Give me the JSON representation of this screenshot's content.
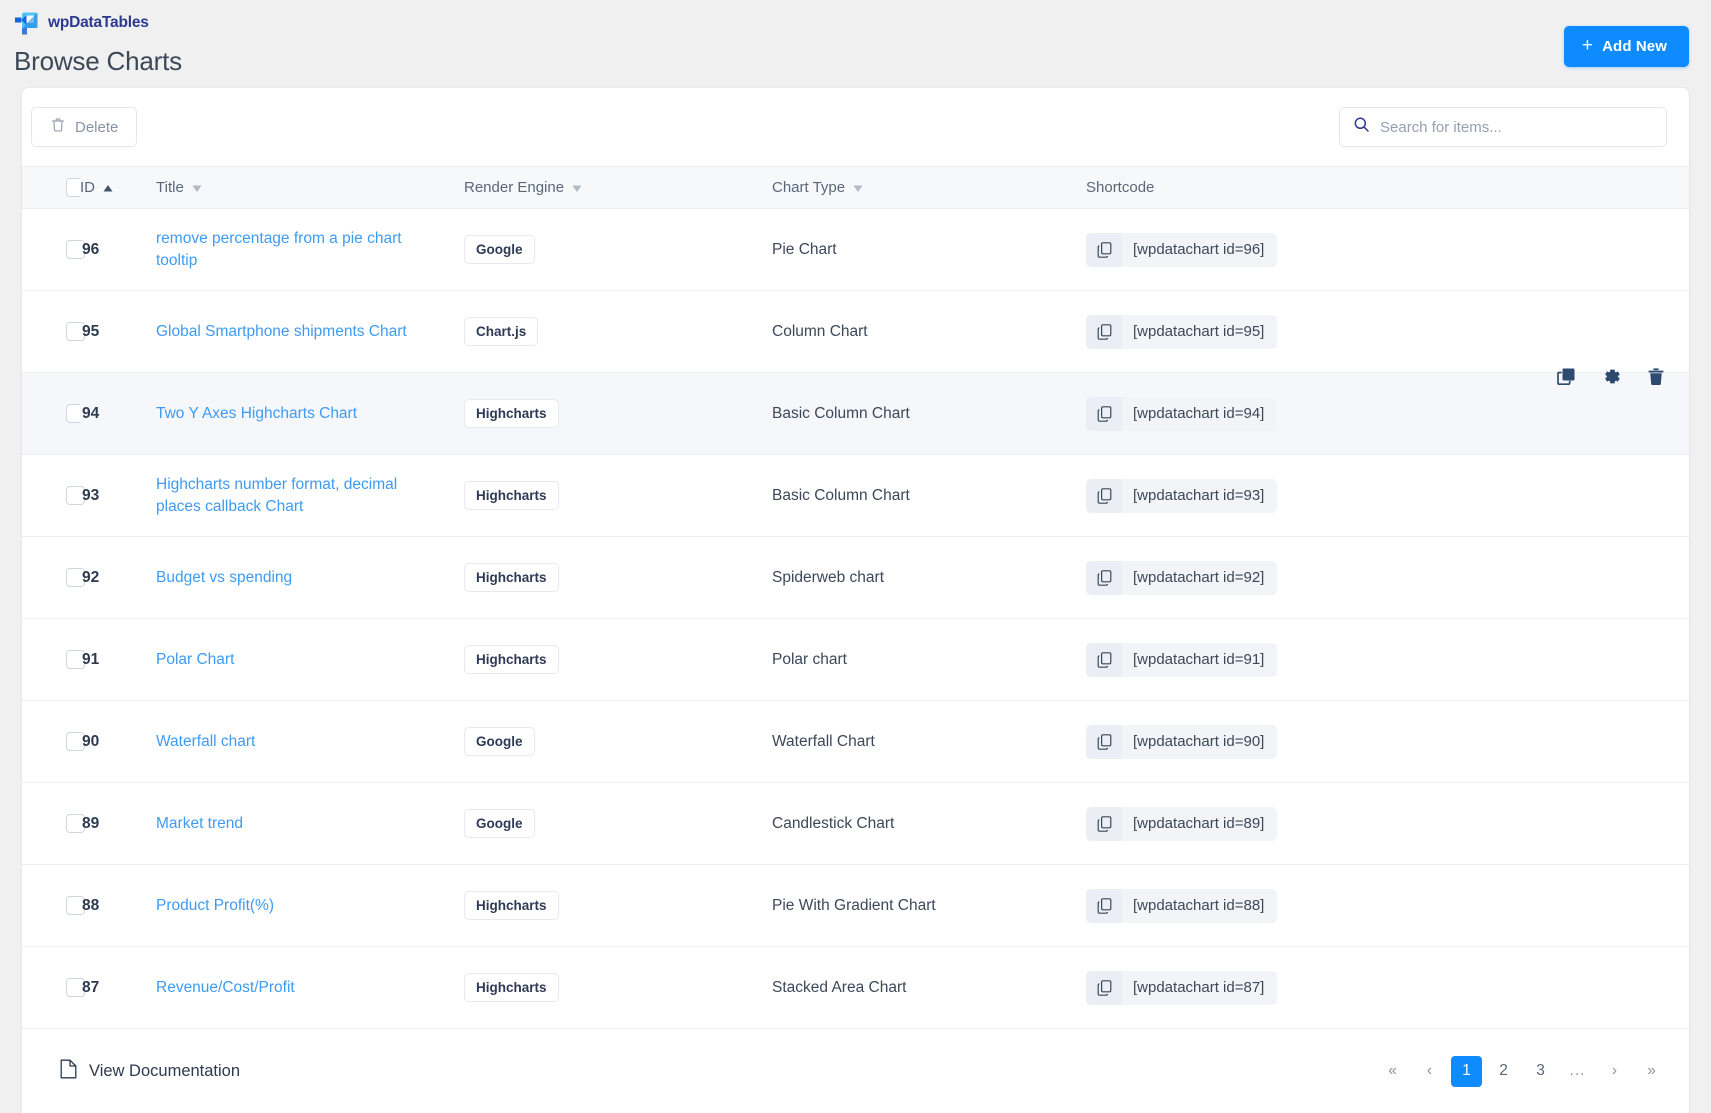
{
  "app": {
    "brand_name": "wpDataTables",
    "page_title": "Browse Charts",
    "add_new_label": "Add New",
    "add_new_plus": "+",
    "accent_color": "#0d8bff",
    "link_color": "#3e9bf4"
  },
  "toolbar": {
    "delete_label": "Delete",
    "search_placeholder": "Search for items...",
    "search_value": ""
  },
  "table": {
    "columns": [
      {
        "key": "check",
        "label": "",
        "sort": "none"
      },
      {
        "key": "id",
        "label": "ID",
        "sort": "asc"
      },
      {
        "key": "title",
        "label": "Title",
        "sort": "desc"
      },
      {
        "key": "engine",
        "label": "Render Engine",
        "sort": "desc"
      },
      {
        "key": "charttype",
        "label": "Chart Type",
        "sort": "desc"
      },
      {
        "key": "shortcode",
        "label": "Shortcode",
        "sort": "none"
      }
    ],
    "rows": [
      {
        "id": "96",
        "title": "remove percentage from a pie chart tooltip",
        "engine": "Google",
        "type": "Pie Chart",
        "shortcode": "[wpdatachart id=96]",
        "hovered": false
      },
      {
        "id": "95",
        "title": "Global Smartphone shipments Chart",
        "engine": "Chart.js",
        "type": "Column Chart",
        "shortcode": "[wpdatachart id=95]",
        "hovered": false
      },
      {
        "id": "94",
        "title": "Two Y Axes Highcharts Chart",
        "engine": "Highcharts",
        "type": "Basic Column Chart",
        "shortcode": "[wpdatachart id=94]",
        "hovered": true
      },
      {
        "id": "93",
        "title": "Highcharts number format, decimal places callback Chart",
        "engine": "Highcharts",
        "type": "Basic Column Chart",
        "shortcode": "[wpdatachart id=93]",
        "hovered": false
      },
      {
        "id": "92",
        "title": "Budget vs spending",
        "engine": "Highcharts",
        "type": "Spiderweb chart",
        "shortcode": "[wpdatachart id=92]",
        "hovered": false
      },
      {
        "id": "91",
        "title": "Polar Chart",
        "engine": "Highcharts",
        "type": "Polar chart",
        "shortcode": "[wpdatachart id=91]",
        "hovered": false
      },
      {
        "id": "90",
        "title": "Waterfall chart",
        "engine": "Google",
        "type": "Waterfall Chart",
        "shortcode": "[wpdatachart id=90]",
        "hovered": false
      },
      {
        "id": "89",
        "title": "Market trend",
        "engine": "Google",
        "type": "Candlestick Chart",
        "shortcode": "[wpdatachart id=89]",
        "hovered": false
      },
      {
        "id": "88",
        "title": "Product Profit(%)",
        "engine": "Highcharts",
        "type": "Pie With Gradient Chart",
        "shortcode": "[wpdatachart id=88]",
        "hovered": false
      },
      {
        "id": "87",
        "title": "Revenue/Cost/Profit",
        "engine": "Highcharts",
        "type": "Stacked Area Chart",
        "shortcode": "[wpdatachart id=87]",
        "hovered": false
      }
    ],
    "row_actions": [
      "duplicate-icon",
      "gear-icon",
      "trash-icon"
    ]
  },
  "footer": {
    "doc_label": "View Documentation",
    "pagination": {
      "first": "«",
      "prev": "‹",
      "pages": [
        "1",
        "2",
        "3"
      ],
      "ellipsis": "...",
      "next": "›",
      "last": "»",
      "current": "1"
    }
  },
  "icons": {
    "search": "search-icon",
    "trash": "trash-icon",
    "copy": "copy-icon",
    "gear": "gear-icon",
    "document": "document-icon",
    "sort_asc": "caret-up-icon",
    "sort_desc": "caret-down-icon"
  }
}
